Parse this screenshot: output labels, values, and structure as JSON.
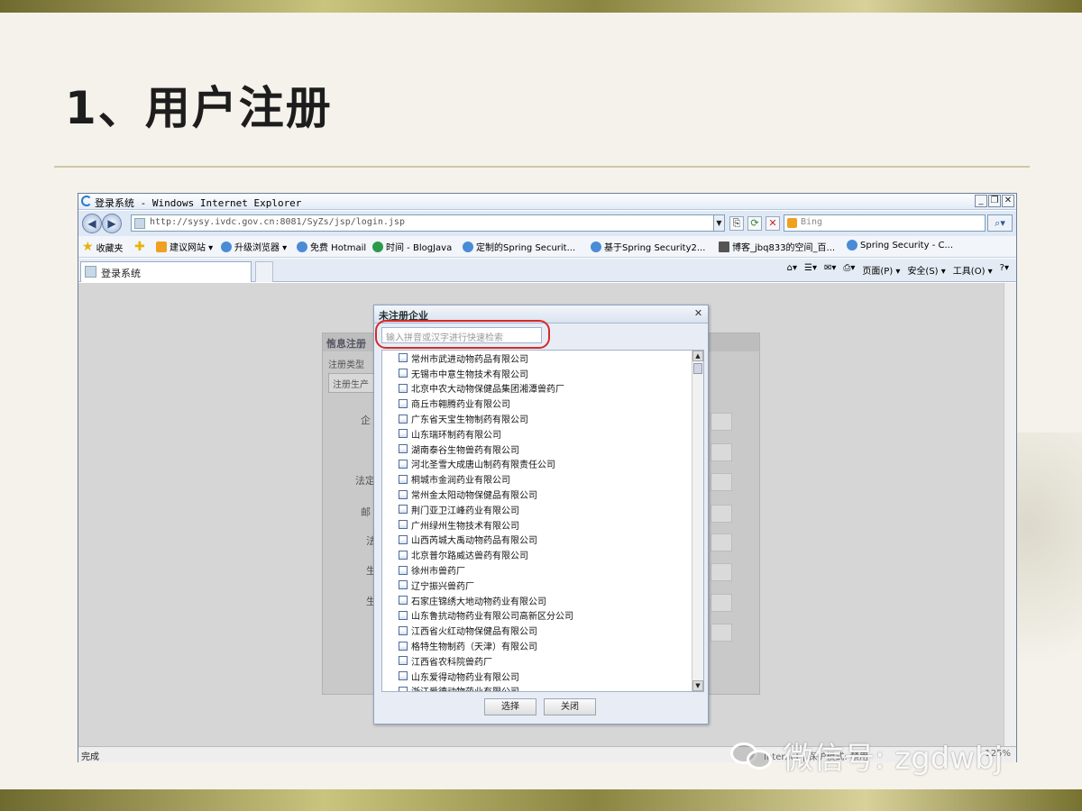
{
  "slide": {
    "title": "1、用户注册"
  },
  "browser": {
    "window_title": "登录系统 - Windows Internet Explorer",
    "address": "http://sysy.ivdc.gov.cn:8081/SyZs/jsp/login.jsp",
    "search_placeholder": "Bing",
    "favorites_label": "收藏夹",
    "favorites": [
      "建议网站 ▾",
      "升级浏览器 ▾",
      "免费 Hotmail",
      "时间 - BlogJava",
      "定制的Spring Securit...",
      "基于Spring Security2...",
      "博客_jbq833的空间_百...",
      "Spring Security - C..."
    ],
    "tab_label": "登录系统",
    "command_bar": [
      "页面(P) ▾",
      "安全(S) ▾",
      "工具(O) ▾"
    ],
    "status_text": "完成",
    "status_zone": "Internet | 保护模式: 禁用",
    "zoom": "125%"
  },
  "background_form": {
    "title": "信息注册",
    "subtitle": "注册类型",
    "tab": "注册生产",
    "labels": [
      "企",
      "",
      "法定",
      "邮",
      "法",
      "生",
      "生",
      ""
    ]
  },
  "modal": {
    "title": "未注册企业",
    "search_placeholder": "输入拼音或汉字进行快速检索",
    "items": [
      "常州市武进动物药品有限公司",
      "无锡市中意生物技术有限公司",
      "北京中农大动物保健品集团湘潭兽药厂",
      "商丘市翱腾药业有限公司",
      "广东省天宝生物制药有限公司",
      "山东瑞环制药有限公司",
      "湖南泰谷生物兽药有限公司",
      "河北圣雪大成唐山制药有限责任公司",
      "桐城市金润药业有限公司",
      "常州金太阳动物保健品有限公司",
      "荆门亚卫江峰药业有限公司",
      "广州绿州生物技术有限公司",
      "山西芮城大禹动物药品有限公司",
      "北京普尔路威达兽药有限公司",
      "徐州市兽药厂",
      "辽宁振兴兽药厂",
      "石家庄锦绣大地动物药业有限公司",
      "山东鲁抗动物药业有限公司高新区分公司",
      "江西省火红动物保健品有限公司",
      "格特生物制药（天津）有限公司",
      "江西省农科院兽药厂",
      "山东爱得动物药业有限公司",
      "浙江爱德动物药业有限公司"
    ],
    "select_button": "选择",
    "close_button": "关闭"
  },
  "watermark": {
    "text": "微信号: zgdwbj"
  }
}
